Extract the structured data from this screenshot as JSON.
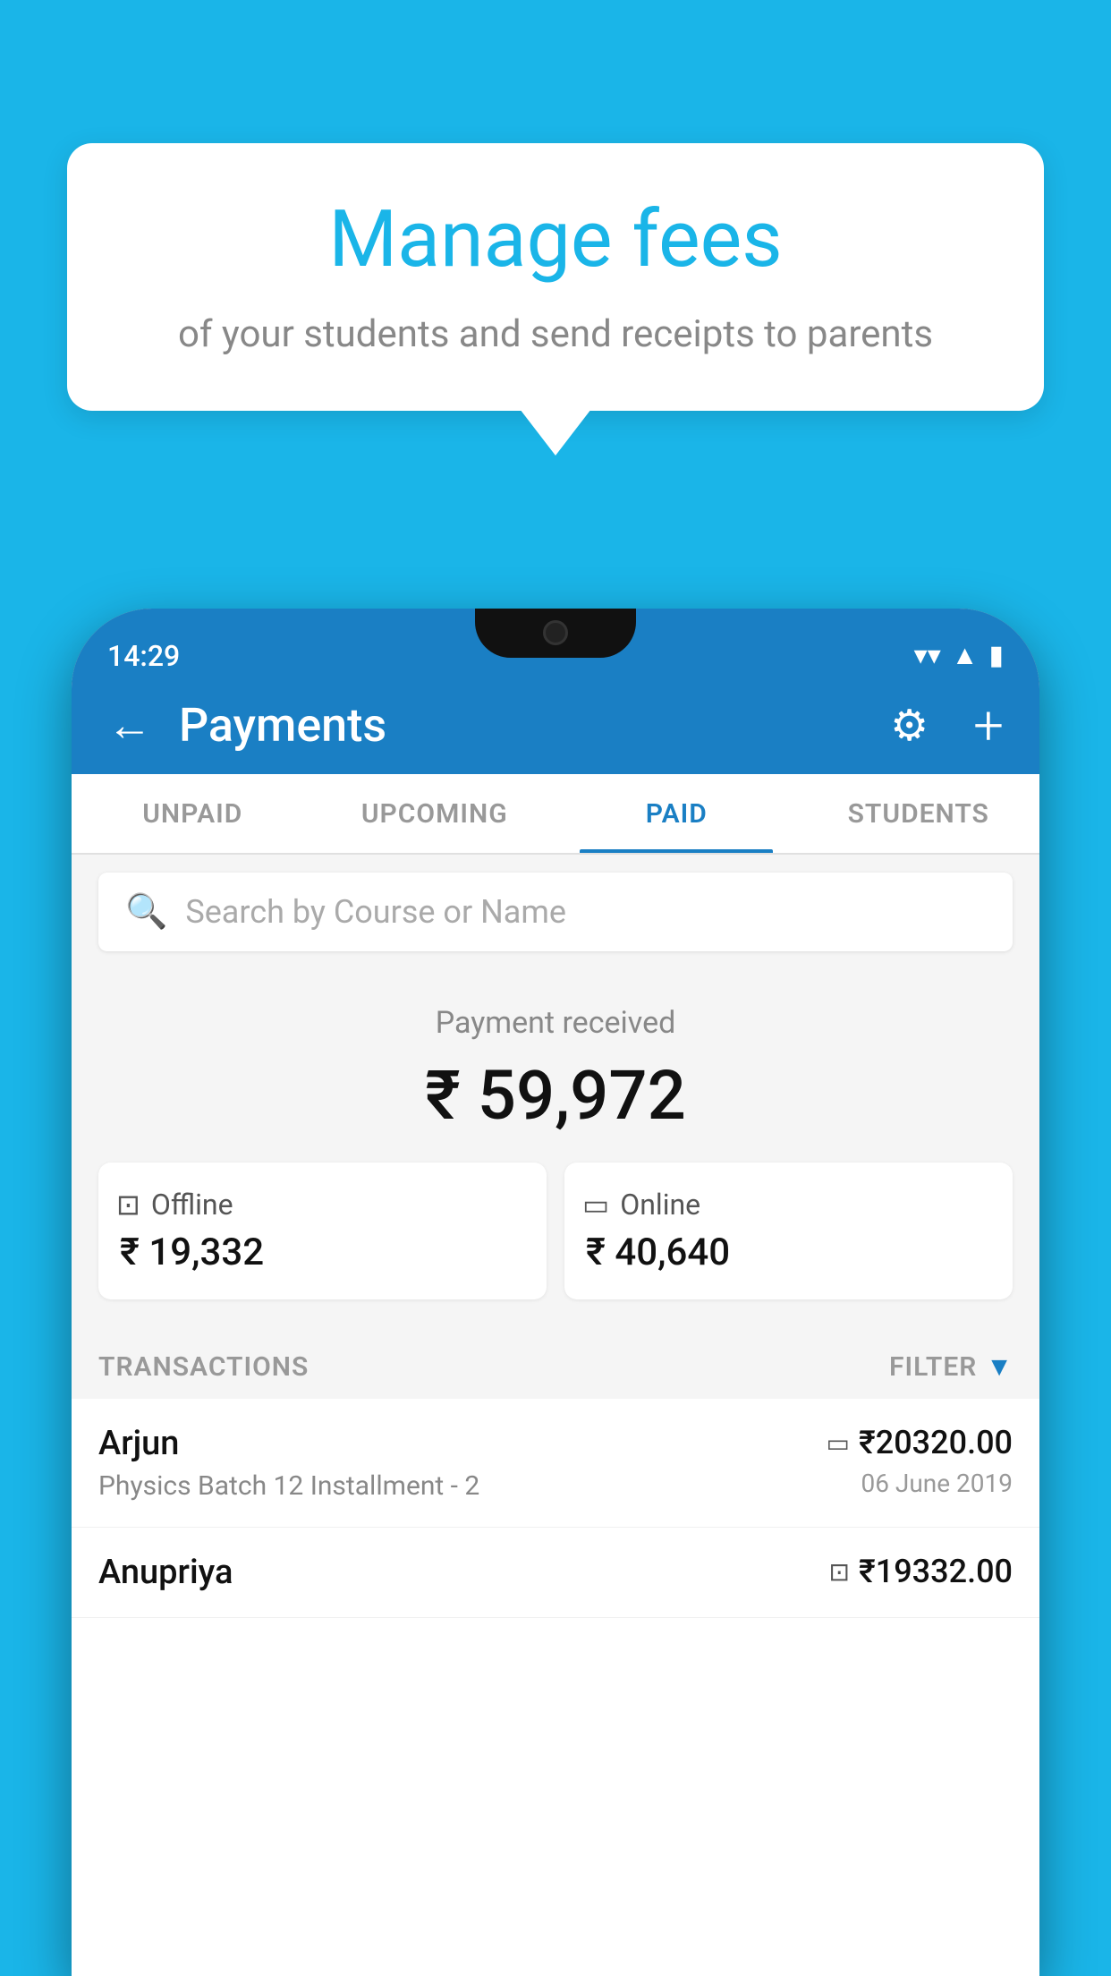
{
  "page": {
    "bg_color": "#1ab5e8"
  },
  "bubble": {
    "title": "Manage fees",
    "subtitle": "of your students and send receipts to parents"
  },
  "status_bar": {
    "time": "14:29"
  },
  "header": {
    "title": "Payments",
    "back_label": "←",
    "plus_label": "+"
  },
  "tabs": [
    {
      "id": "unpaid",
      "label": "UNPAID",
      "active": false
    },
    {
      "id": "upcoming",
      "label": "UPCOMING",
      "active": false
    },
    {
      "id": "paid",
      "label": "PAID",
      "active": true
    },
    {
      "id": "students",
      "label": "STUDENTS",
      "active": false
    }
  ],
  "search": {
    "placeholder": "Search by Course or Name"
  },
  "payment_summary": {
    "received_label": "Payment received",
    "total_amount": "₹ 59,972",
    "offline_label": "Offline",
    "offline_amount": "₹ 19,332",
    "online_label": "Online",
    "online_amount": "₹ 40,640"
  },
  "transactions": {
    "header_label": "TRANSACTIONS",
    "filter_label": "FILTER",
    "rows": [
      {
        "name": "Arjun",
        "course": "Physics Batch 12 Installment - 2",
        "amount": "₹20320.00",
        "date": "06 June 2019",
        "payment_type": "card"
      },
      {
        "name": "Anupriya",
        "course": "",
        "amount": "₹19332.00",
        "date": "",
        "payment_type": "offline"
      }
    ]
  }
}
